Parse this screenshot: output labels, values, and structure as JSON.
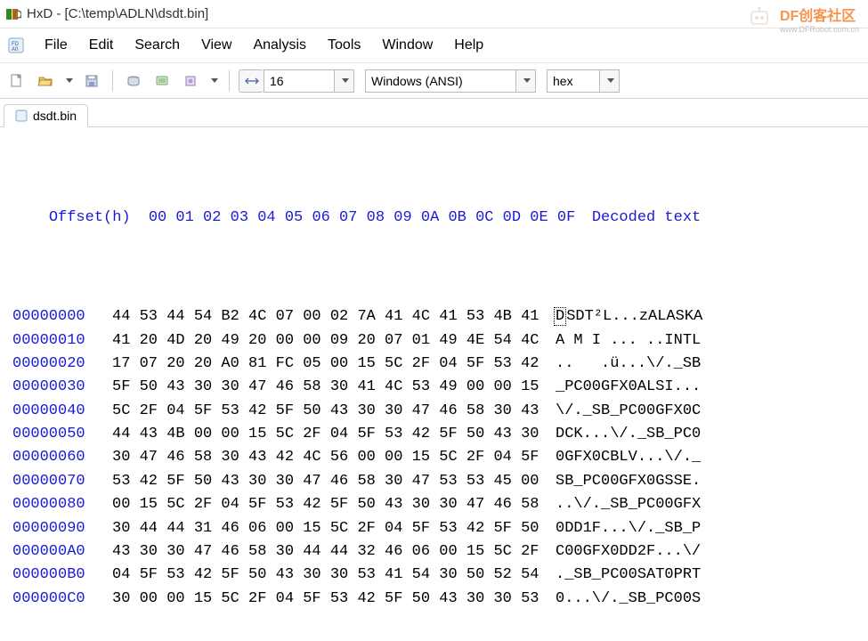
{
  "window": {
    "title": "HxD - [C:\\temp\\ADLN\\dsdt.bin]"
  },
  "menu": {
    "file": "File",
    "edit": "Edit",
    "search": "Search",
    "view": "View",
    "analysis": "Analysis",
    "tools": "Tools",
    "window": "Window",
    "help": "Help"
  },
  "toolbar": {
    "bytes_per_row": "16",
    "encoding": "Windows (ANSI)",
    "base": "hex"
  },
  "tab": {
    "label": "dsdt.bin"
  },
  "hex": {
    "header_offset": "Offset(h)",
    "header_cols": "00 01 02 03 04 05 06 07 08 09 0A 0B 0C 0D 0E 0F",
    "header_decoded": "Decoded text",
    "rows": [
      {
        "offset": "00000000",
        "bytes": "44 53 44 54 B2 4C 07 00 02 7A 41 4C 41 53 4B 41",
        "ascii_caret": "D",
        "ascii_rest": "SDT²L...zALASKA"
      },
      {
        "offset": "00000010",
        "bytes": "41 20 4D 20 49 20 00 00 09 20 07 01 49 4E 54 4C",
        "ascii": "A M I ... ..INTL"
      },
      {
        "offset": "00000020",
        "bytes": "17 07 20 20 A0 81 FC 05 00 15 5C 2F 04 5F 53 42",
        "ascii": "..   .ü...\\/._SB"
      },
      {
        "offset": "00000030",
        "bytes": "5F 50 43 30 30 47 46 58 30 41 4C 53 49 00 00 15",
        "ascii": "_PC00GFX0ALSI..."
      },
      {
        "offset": "00000040",
        "bytes": "5C 2F 04 5F 53 42 5F 50 43 30 30 47 46 58 30 43",
        "ascii": "\\/._SB_PC00GFX0C"
      },
      {
        "offset": "00000050",
        "bytes": "44 43 4B 00 00 15 5C 2F 04 5F 53 42 5F 50 43 30",
        "ascii": "DCK...\\/._SB_PC0"
      },
      {
        "offset": "00000060",
        "bytes": "30 47 46 58 30 43 42 4C 56 00 00 15 5C 2F 04 5F",
        "ascii": "0GFX0CBLV...\\/._"
      },
      {
        "offset": "00000070",
        "bytes": "53 42 5F 50 43 30 30 47 46 58 30 47 53 53 45 00",
        "ascii": "SB_PC00GFX0GSSE."
      },
      {
        "offset": "00000080",
        "bytes": "00 15 5C 2F 04 5F 53 42 5F 50 43 30 30 47 46 58",
        "ascii": "..\\/._SB_PC00GFX"
      },
      {
        "offset": "00000090",
        "bytes": "30 44 44 31 46 06 00 15 5C 2F 04 5F 53 42 5F 50",
        "ascii": "0DD1F...\\/._SB_P"
      },
      {
        "offset": "000000A0",
        "bytes": "43 30 30 47 46 58 30 44 44 32 46 06 00 15 5C 2F",
        "ascii": "C00GFX0DD2F...\\/"
      },
      {
        "offset": "000000B0",
        "bytes": "04 5F 53 42 5F 50 43 30 30 53 41 54 30 50 52 54",
        "ascii": "._SB_PC00SAT0PRT"
      },
      {
        "offset": "000000C0",
        "bytes": "30 00 00 15 5C 2F 04 5F 53 42 5F 50 43 30 30 53",
        "ascii": "0...\\/._SB_PC00S"
      }
    ]
  },
  "watermark": {
    "main": "DF创客社区",
    "sub": "www.DFRobot.com.cn"
  }
}
